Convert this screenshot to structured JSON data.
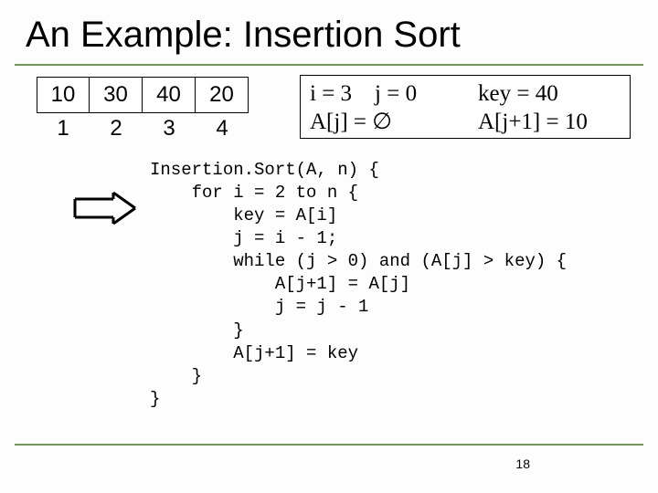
{
  "title": "An Example: Insertion Sort",
  "array": {
    "cells": [
      "10",
      "30",
      "40",
      "20"
    ],
    "indices": [
      "1",
      "2",
      "3",
      "4"
    ]
  },
  "status": {
    "i": "i = 3",
    "j": "j = 0",
    "key": "key = 40",
    "aj": "A[j] = ∅",
    "aj1": "A[j+1] = 10"
  },
  "code": "Insertion.Sort(A, n) {\n    for i = 2 to n {\n        key = A[i]\n        j = i - 1;\n        while (j > 0) and (A[j] > key) {\n            A[j+1] = A[j]\n            j = j - 1\n        }\n        A[j+1] = key\n    }\n}",
  "page_number": "18",
  "icons": {
    "arrow": "double-right-arrow-icon"
  }
}
